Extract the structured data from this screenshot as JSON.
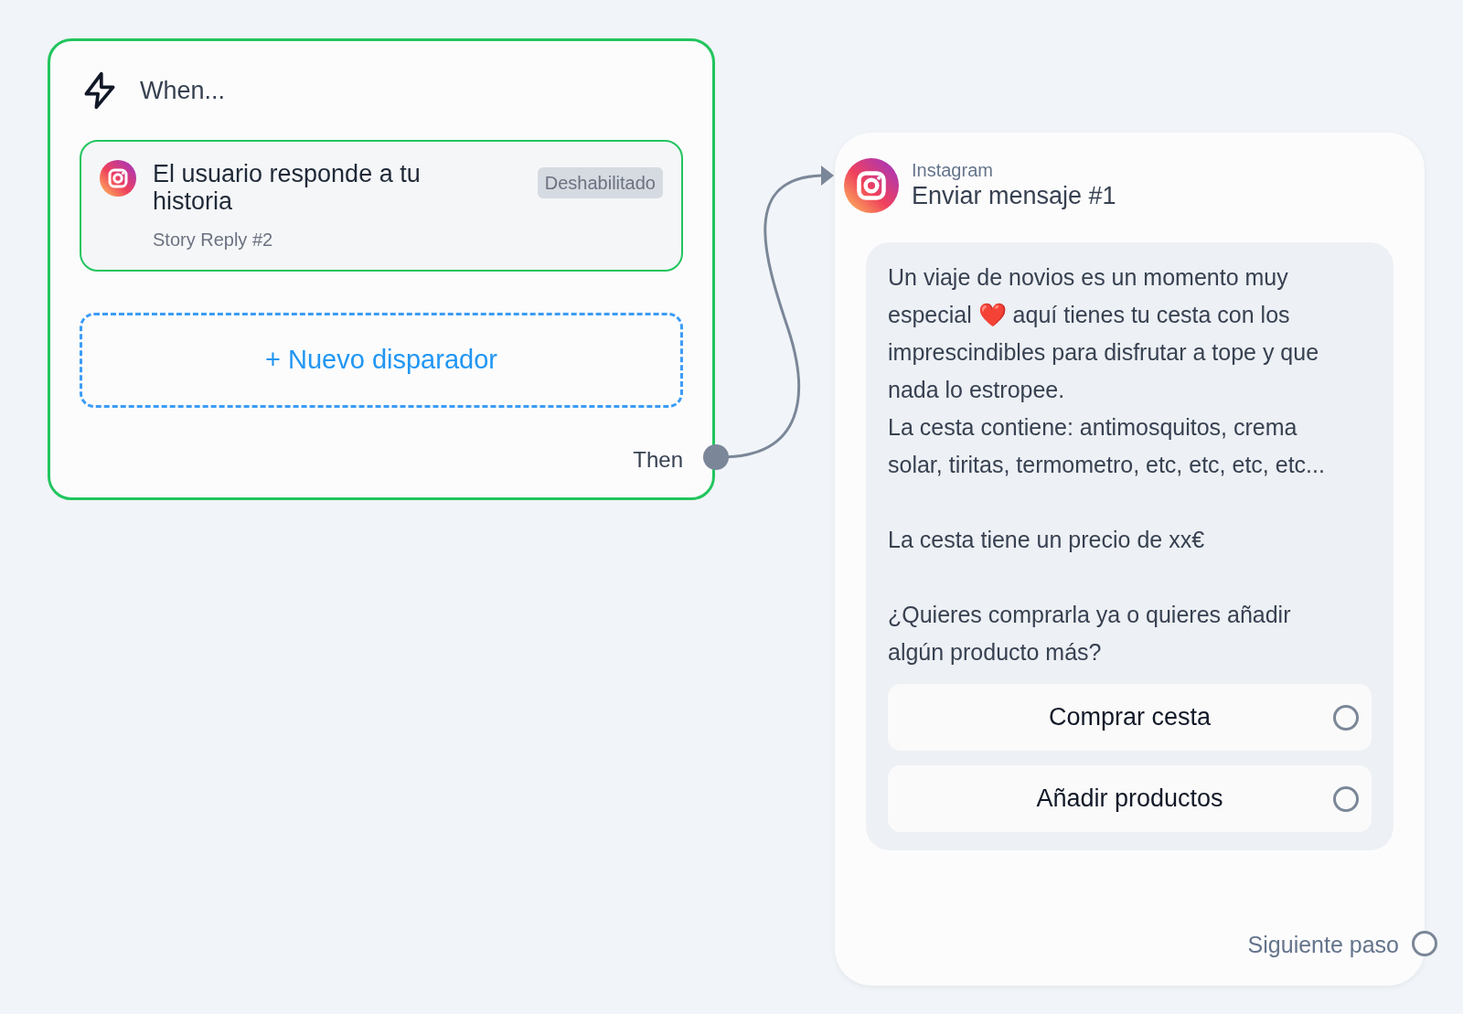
{
  "trigger_node": {
    "title": "When...",
    "triggers": [
      {
        "title": "El usuario responde a tu historia",
        "subtitle": "Story Reply #2",
        "badge": "Deshabilitado"
      }
    ],
    "add_trigger": "+ Nuevo disparador",
    "output_label": "Then"
  },
  "message_node": {
    "channel": "Instagram",
    "title": "Enviar mensaje #1",
    "message": "Un viaje de novios es un momento muy especial ❤️ aquí tienes tu cesta con los imprescindibles para disfrutar a tope y que nada lo estropee.\nLa cesta contiene: antimosquitos, crema solar, tiritas, termometro, etc, etc, etc, etc...\n\nLa cesta tiene un precio de xx€\n\n¿Quieres comprarla ya o quieres añadir algún producto más?",
    "buttons": [
      {
        "label": "Comprar cesta"
      },
      {
        "label": "Añadir productos"
      }
    ],
    "next_step": "Siguiente paso"
  }
}
